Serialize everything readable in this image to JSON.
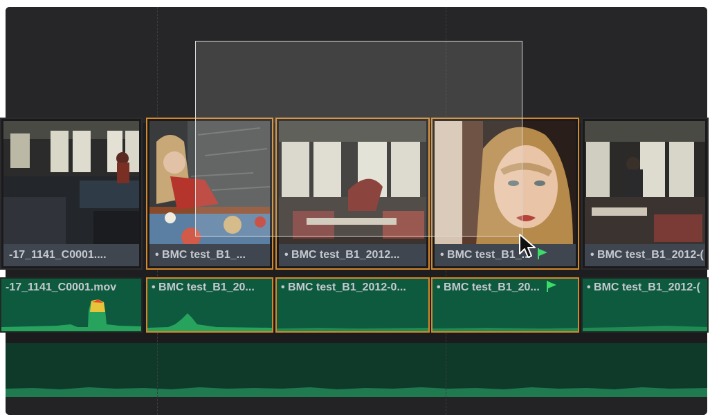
{
  "timeline": {
    "video_clips": [
      {
        "label": "-17_1141_C0001....",
        "selected": false,
        "flagged": false
      },
      {
        "label": "• BMC test_B1_...",
        "selected": true,
        "flagged": false
      },
      {
        "label": "• BMC test_B1_2012...",
        "selected": true,
        "flagged": false
      },
      {
        "label": "• BMC test_B1_...",
        "selected": true,
        "flagged": true
      },
      {
        "label": "• BMC test_B1_2012-(",
        "selected": false,
        "flagged": false
      }
    ],
    "audio_clips": [
      {
        "label": "-17_1141_C0001.mov",
        "selected": false,
        "flagged": false
      },
      {
        "label": "• BMC test_B1_20...",
        "selected": true,
        "flagged": false
      },
      {
        "label": "• BMC test_B1_2012-0...",
        "selected": true,
        "flagged": false
      },
      {
        "label": "• BMC test_B1_20...",
        "selected": true,
        "flagged": true
      },
      {
        "label": "• BMC test_B1_2012-(",
        "selected": false,
        "flagged": false
      }
    ]
  },
  "colors": {
    "selection_border": "#d4882a",
    "flag": "#3ddc6a",
    "audio_clip": "#0e5a3e",
    "label_bar": "#3f4650"
  },
  "icons": [
    "flag-icon",
    "cursor-arrow-icon"
  ]
}
